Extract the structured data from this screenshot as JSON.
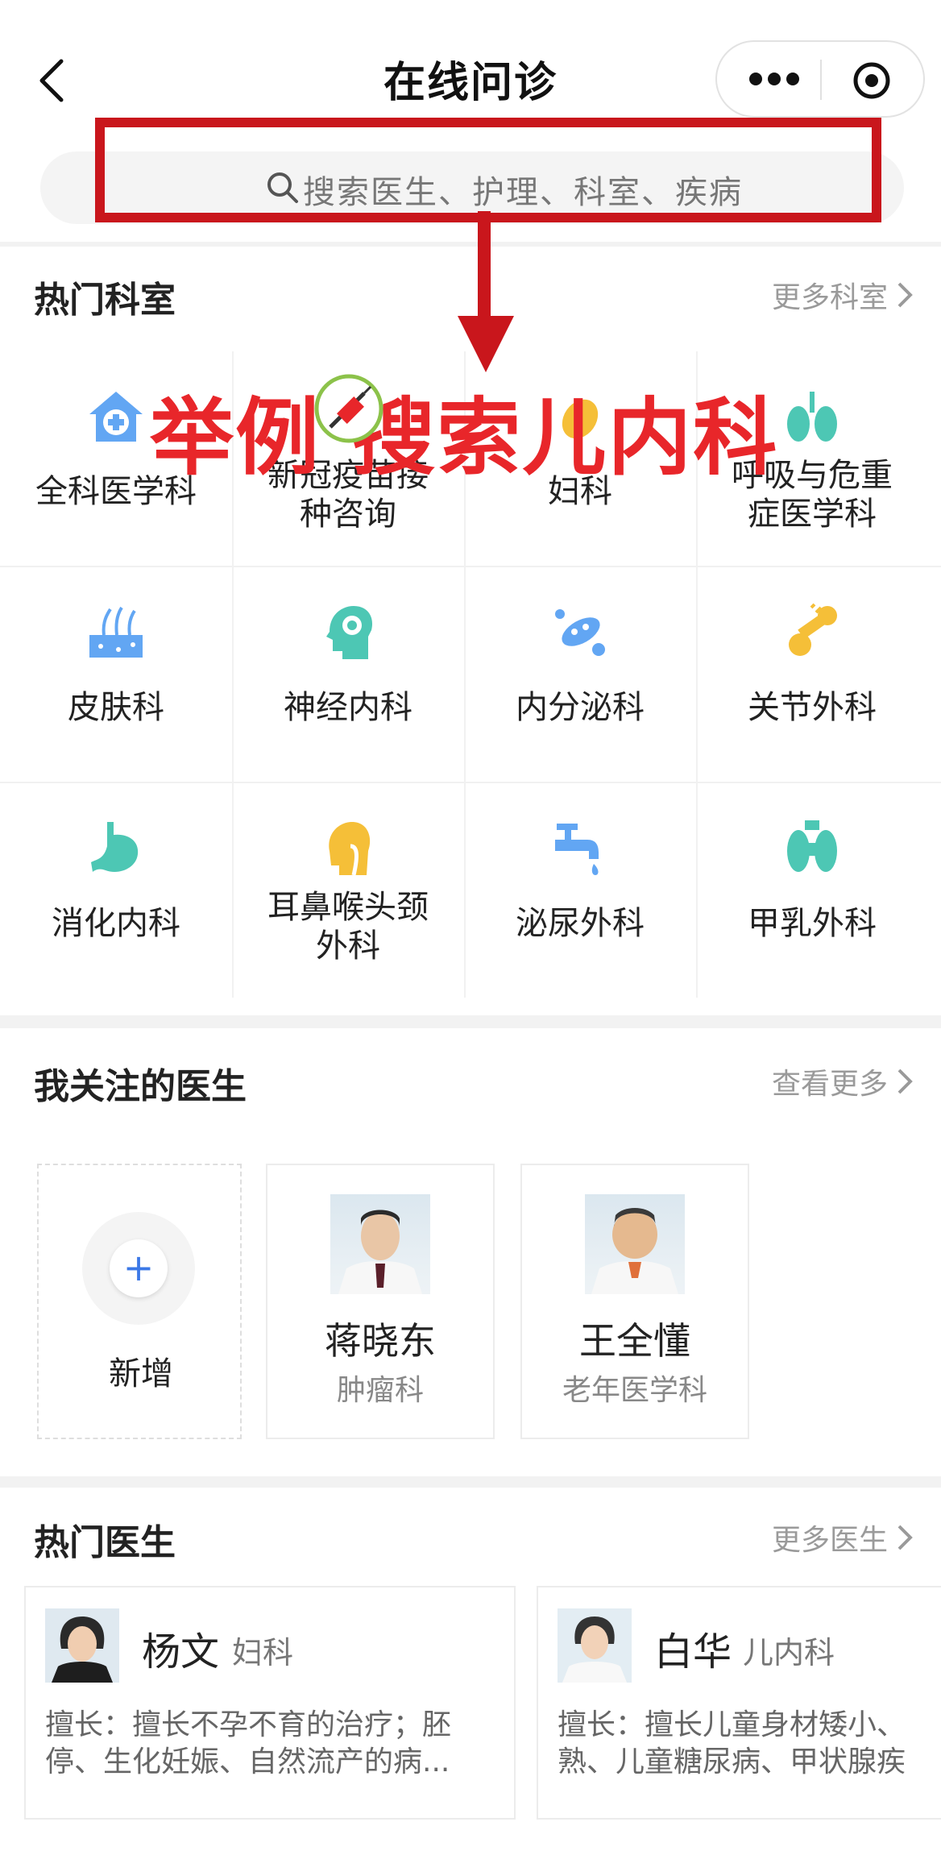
{
  "header": {
    "title": "在线问诊",
    "search_placeholder": "搜索医生、护理、科室、疾病"
  },
  "annotation": {
    "text": "举例  搜索儿内科"
  },
  "departments": {
    "title": "热门科室",
    "more": "更多科室",
    "items": [
      {
        "label": "全科医学科",
        "icon": "house-plus-icon"
      },
      {
        "label": "新冠疫苗接\n种咨询",
        "icon": "vaccine-icon"
      },
      {
        "label": "妇科",
        "icon": "uterus-icon"
      },
      {
        "label": "呼吸与危重\n症医学科",
        "icon": "lungs-icon"
      },
      {
        "label": "皮肤科",
        "icon": "skin-icon"
      },
      {
        "label": "神经内科",
        "icon": "brain-head-icon"
      },
      {
        "label": "内分泌科",
        "icon": "bacteria-icon"
      },
      {
        "label": "关节外科",
        "icon": "bone-joint-icon"
      },
      {
        "label": "消化内科",
        "icon": "stomach-icon"
      },
      {
        "label": "耳鼻喉头颈\n外科",
        "icon": "throat-icon"
      },
      {
        "label": "泌尿外科",
        "icon": "faucet-icon"
      },
      {
        "label": "甲乳外科",
        "icon": "thyroid-icon"
      }
    ]
  },
  "followed": {
    "title": "我关注的医生",
    "more": "查看更多",
    "add_label": "新增",
    "add_symbol": "+",
    "doctors": [
      {
        "name": "蒋晓东",
        "dept": "肿瘤科"
      },
      {
        "name": "王全懂",
        "dept": "老年医学科"
      }
    ]
  },
  "hot_doctors": {
    "title": "热门医生",
    "more": "更多医生",
    "items": [
      {
        "name": "杨文",
        "dept": "妇科",
        "desc": "擅长：擅长不孕不育的治疗；胚\n停、生化妊娠、自然流产的病..."
      },
      {
        "name": "白华",
        "dept": "儿内科",
        "desc": "擅长：擅长儿童身材矮小、\n熟、儿童糖尿病、甲状腺疾"
      }
    ]
  },
  "colors": {
    "annotation_red": "#c9161c",
    "annotation_text": "#e8262a",
    "icon_teal": "#4dc7b4",
    "icon_blue": "#62a6f3",
    "icon_yellow": "#f5bf38",
    "accent_blue": "#3b78e7"
  }
}
